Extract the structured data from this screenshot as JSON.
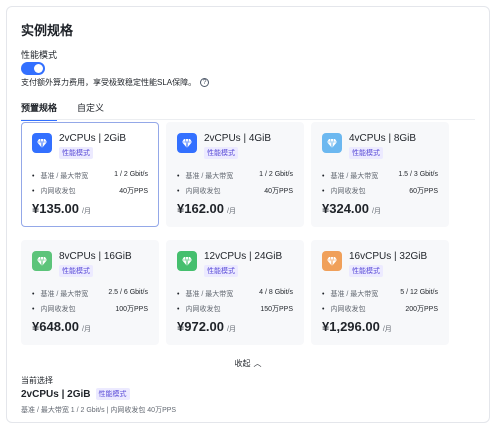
{
  "panel": {
    "title": "实例规格",
    "mode_label": "性能模式",
    "mode_enabled": true,
    "mode_desc": "支付额外算力费用，享受极致稳定性能SLA保障。",
    "help_icon": "question-circle-icon"
  },
  "tabs": [
    {
      "label": "预置规格",
      "active": true
    },
    {
      "label": "自定义",
      "active": false
    }
  ],
  "cards": [
    {
      "spec": "2vCPUs | 2GiB",
      "badge": "性能模式",
      "icon": "diamond-icon",
      "icon_color": "#3370ff",
      "bw_label": "基准 / 最大带宽",
      "bw_value": "1 / 2 Gbit/s",
      "pps_label": "内网收发包",
      "pps_value": "40万PPS",
      "price": "¥135.00",
      "unit": "/月",
      "selected": true
    },
    {
      "spec": "2vCPUs | 4GiB",
      "badge": "性能模式",
      "icon": "diamond-icon",
      "icon_color": "#3370ff",
      "bw_label": "基准 / 最大带宽",
      "bw_value": "1 / 2 Gbit/s",
      "pps_label": "内网收发包",
      "pps_value": "40万PPS",
      "price": "¥162.00",
      "unit": "/月",
      "selected": false
    },
    {
      "spec": "4vCPUs | 8GiB",
      "badge": "性能模式",
      "icon": "diamond-icon",
      "icon_color": "#6cb8f0",
      "bw_label": "基准 / 最大带宽",
      "bw_value": "1.5 / 3 Gbit/s",
      "pps_label": "内网收发包",
      "pps_value": "60万PPS",
      "price": "¥324.00",
      "unit": "/月",
      "selected": false
    },
    {
      "spec": "8vCPUs | 16GiB",
      "badge": "性能模式",
      "icon": "diamond-icon",
      "icon_color": "#5cc47a",
      "bw_label": "基准 / 最大带宽",
      "bw_value": "2.5 / 6 Gbit/s",
      "pps_label": "内网收发包",
      "pps_value": "100万PPS",
      "price": "¥648.00",
      "unit": "/月",
      "selected": false
    },
    {
      "spec": "12vCPUs | 24GiB",
      "badge": "性能模式",
      "icon": "diamond-icon",
      "icon_color": "#45bf6e",
      "bw_label": "基准 / 最大带宽",
      "bw_value": "4 / 8 Gbit/s",
      "pps_label": "内网收发包",
      "pps_value": "150万PPS",
      "price": "¥972.00",
      "unit": "/月",
      "selected": false
    },
    {
      "spec": "16vCPUs | 32GiB",
      "badge": "性能模式",
      "icon": "diamond-icon",
      "icon_color": "#f0a05a",
      "bw_label": "基准 / 最大带宽",
      "bw_value": "5 / 12 Gbit/s",
      "pps_label": "内网收发包",
      "pps_value": "200万PPS",
      "price": "¥1,296.00",
      "unit": "/月",
      "selected": false
    }
  ],
  "collapse_label": "收起",
  "current": {
    "label": "当前选择",
    "spec": "2vCPUs | 2GiB",
    "badge": "性能模式",
    "detail": "基准 / 最大带宽  1 / 2 Gbit/s  |  内网收发包  40万PPS"
  }
}
